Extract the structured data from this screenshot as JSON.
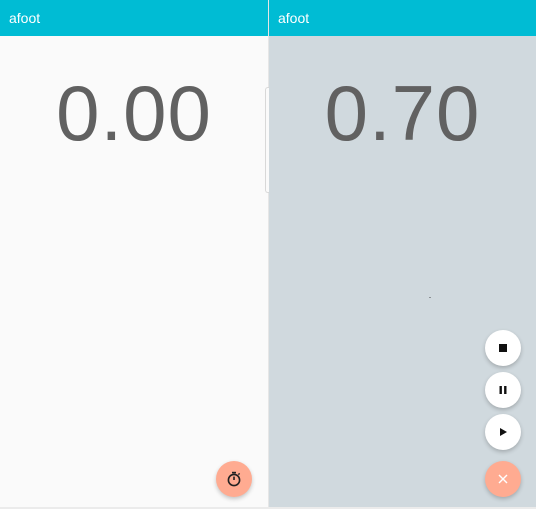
{
  "colors": {
    "appbar": "#00bcd4",
    "left_background": "#fafafa",
    "right_background": "#d0d9de",
    "fab_accent": "#ffab91",
    "counter_text": "#616161"
  },
  "left_screen": {
    "app_title": "afoot",
    "counter_value": "0.00",
    "fab_icon": "stopwatch-icon"
  },
  "right_screen": {
    "app_title": "afoot",
    "counter_value": "0.70",
    "actions": [
      {
        "name": "stop",
        "icon": "stop-icon"
      },
      {
        "name": "pause",
        "icon": "pause-icon"
      },
      {
        "name": "play",
        "icon": "play-icon"
      }
    ],
    "fab_icon": "close-icon"
  }
}
